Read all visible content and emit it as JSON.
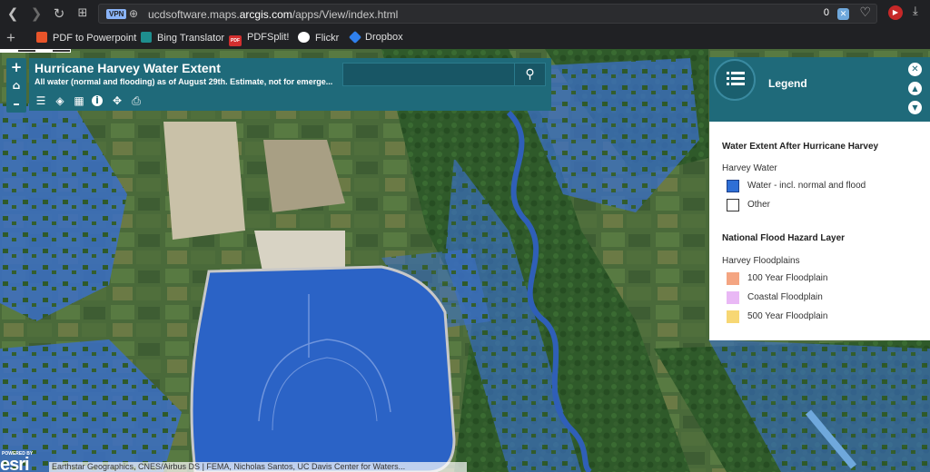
{
  "browser": {
    "url_prefix": "ucdsoftware.maps.",
    "url_domain": "arcgis.com",
    "url_path": "/apps/View/index.html",
    "vpn_label": "VPN",
    "ad_count": "0",
    "bookmarks": [
      {
        "label": "PDF to Powerpoint",
        "icon": "pdf-to-ppt-icon",
        "color": "#e8542a"
      },
      {
        "label": "Bing Translator",
        "icon": "bing-translator-icon",
        "color": "#1e8e8e"
      },
      {
        "label": "PDFSplit!",
        "icon": "pdfsplit-icon",
        "color": "#d32f2f"
      },
      {
        "label": "Flickr",
        "icon": "flickr-icon",
        "color": "#ffffff"
      },
      {
        "label": "Dropbox",
        "icon": "dropbox-icon",
        "color": "#2f80ed"
      }
    ],
    "pdf_badge": "PDF"
  },
  "app": {
    "title": "Hurricane Harvey Water Extent",
    "subtitle": "All water (normal and flooding) as of August 29th. Estimate, not for emerge...",
    "search_placeholder": ""
  },
  "zoom": {
    "in": "+",
    "home": "⌂",
    "out": "–"
  },
  "legend": {
    "title": "Legend",
    "sections": [
      {
        "heading": "Water Extent After Hurricane Harvey",
        "layer": "Harvey Water",
        "items": [
          {
            "label": "Water - incl. normal and flood",
            "color": "#2f6fd6"
          },
          {
            "label": "Other",
            "color": "#ffffff"
          }
        ]
      },
      {
        "heading": "National Flood Hazard Layer",
        "layer": "Harvey Floodplains",
        "items": [
          {
            "label": "100 Year Floodplain",
            "color": "#f4a582"
          },
          {
            "label": "Coastal Floodplain",
            "color": "#e9b8f5"
          },
          {
            "label": "500 Year Floodplain",
            "color": "#f7d774"
          }
        ]
      }
    ]
  },
  "map": {
    "attribution": "Earthstar Geographics, CNES/Airbus DS | FEMA, Nicholas Santos, UC Davis Center for Waters...",
    "esri_powered": "POWERED BY",
    "esri_word": "esri",
    "water_color": "#3a6fc8",
    "accent": "#1f6a7a"
  }
}
